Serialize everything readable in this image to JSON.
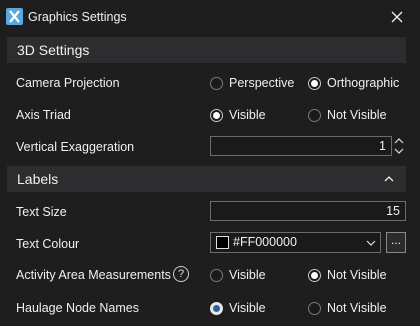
{
  "window": {
    "title": "Graphics Settings",
    "icons": {
      "app": "app-logo-icon",
      "close": "close-icon"
    }
  },
  "sections": {
    "settings3d": {
      "title": "3D Settings"
    },
    "labels": {
      "title": "Labels",
      "icon": "chevron-up-icon"
    }
  },
  "rows": {
    "camera_projection": {
      "label": "Camera Projection",
      "options": [
        "Perspective",
        "Orthographic"
      ],
      "selected": "Orthographic"
    },
    "axis_triad": {
      "label": "Axis Triad",
      "options": [
        "Visible",
        "Not Visible"
      ],
      "selected": "Visible"
    },
    "vertical_exaggeration": {
      "label": "Vertical Exaggeration",
      "value": "1",
      "icon": "spinner-icon"
    },
    "text_size": {
      "label": "Text Size",
      "value": "15"
    },
    "text_colour": {
      "label": "Text Colour",
      "value": "#FF000000",
      "swatch": "#000000",
      "more_label": "...",
      "icon": "chevron-down-icon"
    },
    "activity_area": {
      "label": "Activity Area Measurements",
      "help": "?",
      "options": [
        "Visible",
        "Not Visible"
      ],
      "selected": "Not Visible"
    },
    "haulage_node": {
      "label": "Haulage Node Names",
      "options": [
        "Visible",
        "Not Visible"
      ],
      "selected": "Visible"
    }
  },
  "colors": {
    "background": "#1e1e1e",
    "section_header": "#2d2d2f",
    "accent": "#2d5ea8"
  }
}
